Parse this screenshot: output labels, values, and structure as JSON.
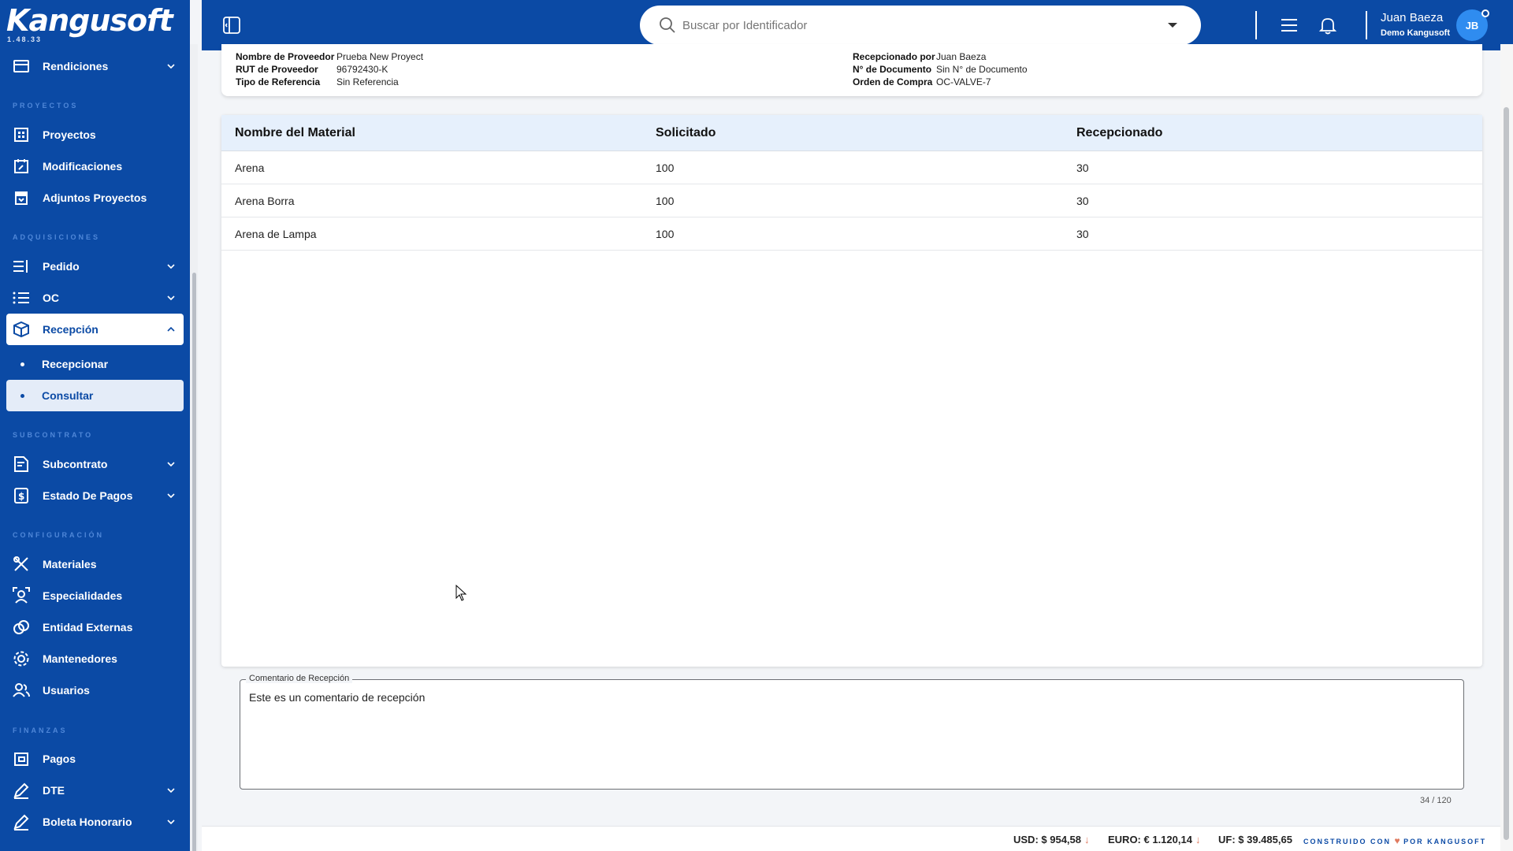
{
  "app": {
    "logo": "Kangusoft",
    "version": "1.48.33"
  },
  "sidebar": {
    "sections": {
      "proyectos": "PROYECTOS",
      "adquisiciones": "ADQUISICIONES",
      "subcontrato": "SUBCONTRATO",
      "configuracion": "CONFIGURACIÓN",
      "finanzas": "FINANZAS"
    },
    "items": {
      "rendiciones": "Rendiciones",
      "proyectos": "Proyectos",
      "modificaciones": "Modificaciones",
      "adjuntos": "Adjuntos Proyectos",
      "pedido": "Pedido",
      "oc": "OC",
      "recepcion": "Recepción",
      "recepcionar": "Recepcionar",
      "consultar": "Consultar",
      "subcontrato": "Subcontrato",
      "estado_pagos": "Estado De Pagos",
      "materiales": "Materiales",
      "especialidades": "Especialidades",
      "entidad_externas": "Entidad Externas",
      "mantenedores": "Mantenedores",
      "usuarios": "Usuarios",
      "pagos": "Pagos",
      "dte": "DTE",
      "boleta": "Boleta Honorario"
    }
  },
  "header": {
    "search_placeholder": "Buscar por Identificador",
    "user_name": "Juan Baeza",
    "user_org": "Demo Kangusoft",
    "avatar_initials": "JB"
  },
  "info": {
    "left": [
      {
        "key": "Nombre de Proveedor",
        "value": "Prueba New Proyect"
      },
      {
        "key": "RUT de Proveedor",
        "value": "96792430-K"
      },
      {
        "key": "Tipo de Referencia",
        "value": "Sin Referencia"
      }
    ],
    "right": [
      {
        "key": "Recepcionado por",
        "value": "Juan Baeza"
      },
      {
        "key": "N° de Documento",
        "value": "Sin N° de Documento"
      },
      {
        "key": "Orden de Compra",
        "value": "OC-VALVE-7"
      }
    ]
  },
  "table": {
    "headers": [
      "Nombre del Material",
      "Solicitado",
      "Recepcionado"
    ],
    "rows": [
      [
        "Arena",
        "100",
        "30"
      ],
      [
        "Arena Borra",
        "100",
        "30"
      ],
      [
        "Arena de Lampa",
        "100",
        "30"
      ]
    ]
  },
  "comment": {
    "label": "Comentario de Recepción",
    "value": "Este es un comentario de recepción",
    "counter": "34 / 120"
  },
  "footer": {
    "usd": "USD: $ 954,58",
    "euro": "EURO: € 1.120,14",
    "uf": "UF: $ 39.485,65",
    "credit_left": "CONSTRUIDO CON",
    "credit_right": "POR KANGUSOFT"
  },
  "colors": {
    "brand": "#0b4aa5",
    "table_header": "#e6f0fc",
    "down_arrow": "#e07a5f"
  }
}
